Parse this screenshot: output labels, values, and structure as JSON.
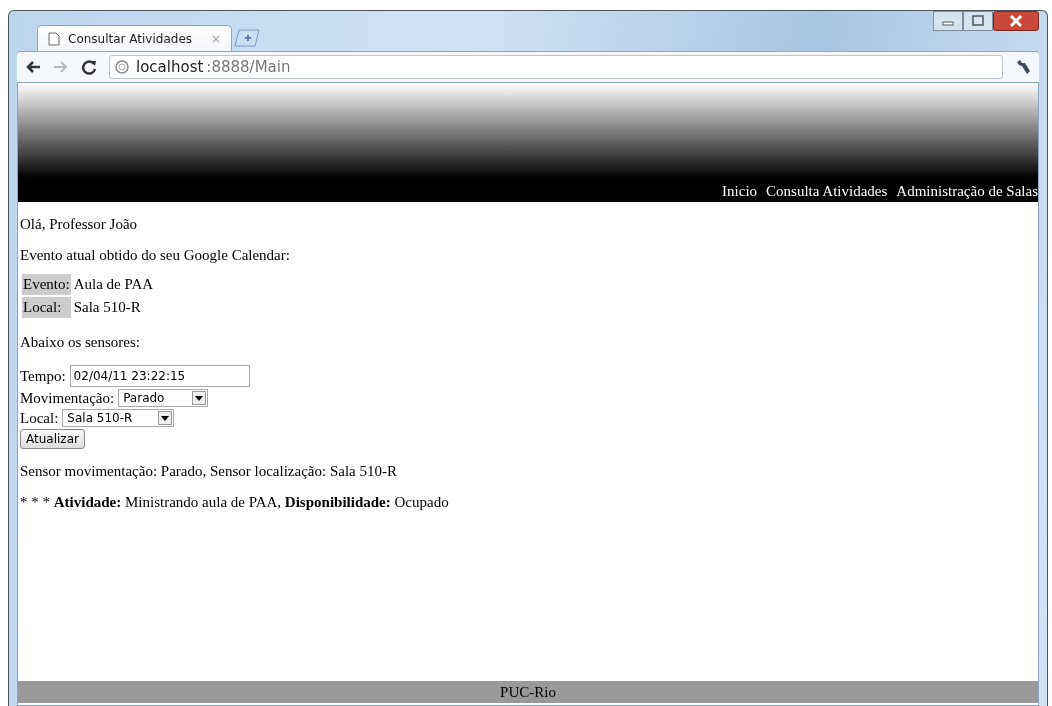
{
  "browser": {
    "tab_title": "Consultar Atividades",
    "tab_close": "×",
    "address": {
      "host": "localhost",
      "rest": ":8888/Main"
    }
  },
  "nav": [
    "Inicio",
    "Consulta Atividades",
    "Administração de Salas"
  ],
  "greeting": "Olá, Professor João",
  "event_intro": "Evento atual obtido do seu Google Calendar:",
  "event_rows": [
    {
      "label": "Evento:",
      "value": "Aula de PAA"
    },
    {
      "label": "Local:",
      "value": "Sala 510-R"
    }
  ],
  "sensors_intro": "Abaixo os sensores:",
  "form": {
    "time": {
      "label": "Tempo:",
      "value": "02/04/11 23:22:15"
    },
    "movement": {
      "label": "Movimentação:",
      "value": "Parado"
    },
    "location": {
      "label": "Local:",
      "value": "Sala 510-R"
    },
    "button": "Atualizar"
  },
  "sensor_status": "Sensor movimentação: Parado, Sensor localização: Sala 510-R",
  "activity": "* * * **Atividade:** Ministrando aula de PAA, **Disponibilidade:** Ocupado",
  "footer": "PUC-Rio"
}
